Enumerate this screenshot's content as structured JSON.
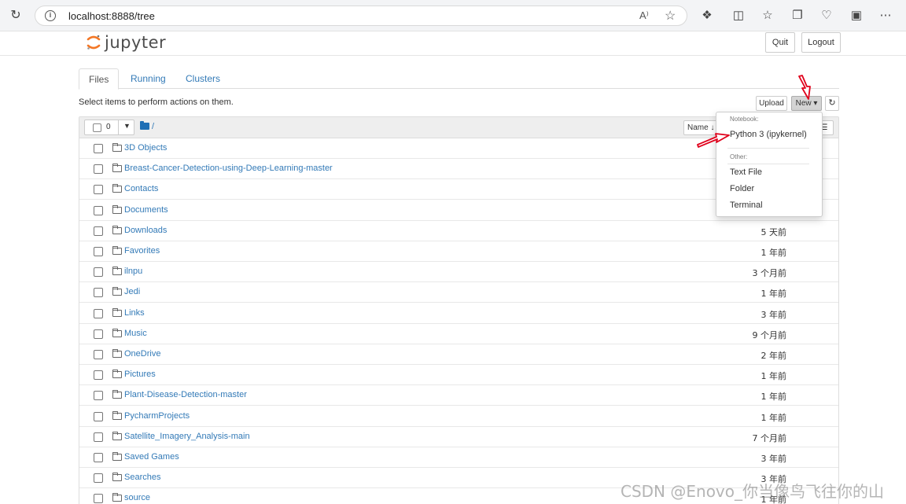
{
  "browser": {
    "url": "localhost:8888/tree",
    "reader_label": "A⁾",
    "info_label": "i"
  },
  "header": {
    "logo_text": "jupyter",
    "quit_label": "Quit",
    "logout_label": "Logout"
  },
  "tabs": [
    {
      "label": "Files",
      "active": true
    },
    {
      "label": "Running",
      "active": false
    },
    {
      "label": "Clusters",
      "active": false
    }
  ],
  "toolbar": {
    "hint": "Select items to perform actions on them.",
    "upload_label": "Upload",
    "new_label": "New ▾",
    "refresh_label": "↻"
  },
  "list_header": {
    "selected_count": "0",
    "path": "/",
    "name_sort_label": "Name ↓",
    "last_modified_label": "☰"
  },
  "files": [
    {
      "name": "3D Objects",
      "modified": ""
    },
    {
      "name": "Breast-Cancer-Detection-using-Deep-Learning-master",
      "modified": ""
    },
    {
      "name": "Contacts",
      "modified": ""
    },
    {
      "name": "Documents",
      "modified": ""
    },
    {
      "name": "Downloads",
      "modified": "5 天前"
    },
    {
      "name": "Favorites",
      "modified": "1 年前"
    },
    {
      "name": "ilnpu",
      "modified": "3 个月前"
    },
    {
      "name": "Jedi",
      "modified": "1 年前"
    },
    {
      "name": "Links",
      "modified": "3 年前"
    },
    {
      "name": "Music",
      "modified": "9 个月前"
    },
    {
      "name": "OneDrive",
      "modified": "2 年前"
    },
    {
      "name": "Pictures",
      "modified": "1 年前"
    },
    {
      "name": "Plant-Disease-Detection-master",
      "modified": "1 年前"
    },
    {
      "name": "PycharmProjects",
      "modified": "1 年前"
    },
    {
      "name": "Satellite_Imagery_Analysis-main",
      "modified": "7 个月前"
    },
    {
      "name": "Saved Games",
      "modified": "3 年前"
    },
    {
      "name": "Searches",
      "modified": "3 年前"
    },
    {
      "name": "source",
      "modified": "1 年前"
    }
  ],
  "new_menu": {
    "notebook_header": "Notebook:",
    "python_kernel": "Python 3 (ipykernel)",
    "other_header": "Other:",
    "text_file": "Text File",
    "folder": "Folder",
    "terminal": "Terminal"
  },
  "watermark": "CSDN @Enovo_你当像鸟飞往你的山",
  "colors": {
    "link": "#337ab7",
    "logo_orange": "#f37726",
    "annotation_red": "#e0001b"
  }
}
